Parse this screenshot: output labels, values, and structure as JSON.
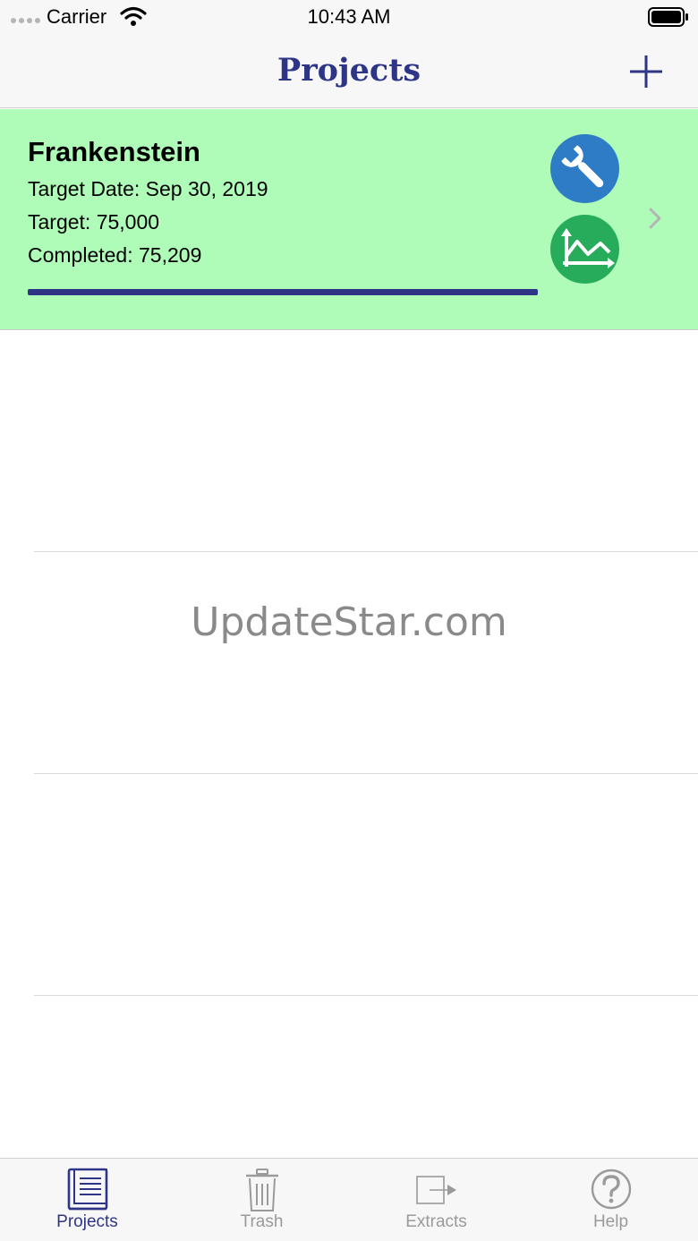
{
  "status_bar": {
    "carrier": "Carrier",
    "time": "10:43 AM"
  },
  "nav": {
    "title": "Projects",
    "add_icon": "plus-icon"
  },
  "project": {
    "name": "Frankenstein",
    "target_date": "Target Date: Sep 30, 2019",
    "target": "Target: 75,000",
    "completed": "Completed: 75,209",
    "progress_fraction": 1.0,
    "settings_icon": "wrench-icon",
    "stats_icon": "chart-icon",
    "background_color": "#aefcb8"
  },
  "watermark": "UpdateStar.com",
  "tabs": [
    {
      "label": "Projects",
      "icon": "book-icon",
      "active": true
    },
    {
      "label": "Trash",
      "icon": "trash-icon",
      "active": false
    },
    {
      "label": "Extracts",
      "icon": "export-icon",
      "active": false
    },
    {
      "label": "Help",
      "icon": "help-icon",
      "active": false
    }
  ],
  "colors": {
    "accent": "#2e3587",
    "settings_button": "#2f7cc6",
    "stats_button": "#27ac5c"
  }
}
